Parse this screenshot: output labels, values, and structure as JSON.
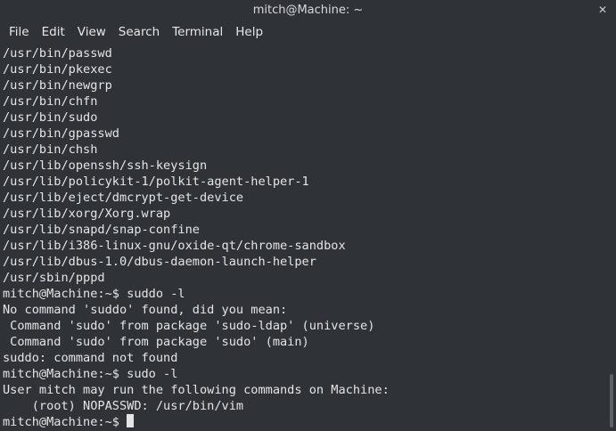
{
  "window": {
    "title": "mitch@Machine: ~",
    "close_glyph": "✕"
  },
  "menu": [
    "File",
    "Edit",
    "View",
    "Search",
    "Terminal",
    "Help"
  ],
  "terminal": {
    "lines": [
      "/usr/bin/passwd",
      "/usr/bin/pkexec",
      "/usr/bin/newgrp",
      "/usr/bin/chfn",
      "/usr/bin/sudo",
      "/usr/bin/gpasswd",
      "/usr/bin/chsh",
      "/usr/lib/openssh/ssh-keysign",
      "/usr/lib/policykit-1/polkit-agent-helper-1",
      "/usr/lib/eject/dmcrypt-get-device",
      "/usr/lib/xorg/Xorg.wrap",
      "/usr/lib/snapd/snap-confine",
      "/usr/lib/i386-linux-gnu/oxide-qt/chrome-sandbox",
      "/usr/lib/dbus-1.0/dbus-daemon-launch-helper",
      "/usr/sbin/pppd",
      "mitch@Machine:~$ suddo -l",
      "No command 'suddo' found, did you mean:",
      " Command 'sudo' from package 'sudo-ldap' (universe)",
      " Command 'sudo' from package 'sudo' (main)",
      "suddo: command not found",
      "mitch@Machine:~$ sudo -l",
      "User mitch may run the following commands on Machine:",
      "    (root) NOPASSWD: /usr/bin/vim"
    ],
    "prompt": "mitch@Machine:~$ "
  }
}
